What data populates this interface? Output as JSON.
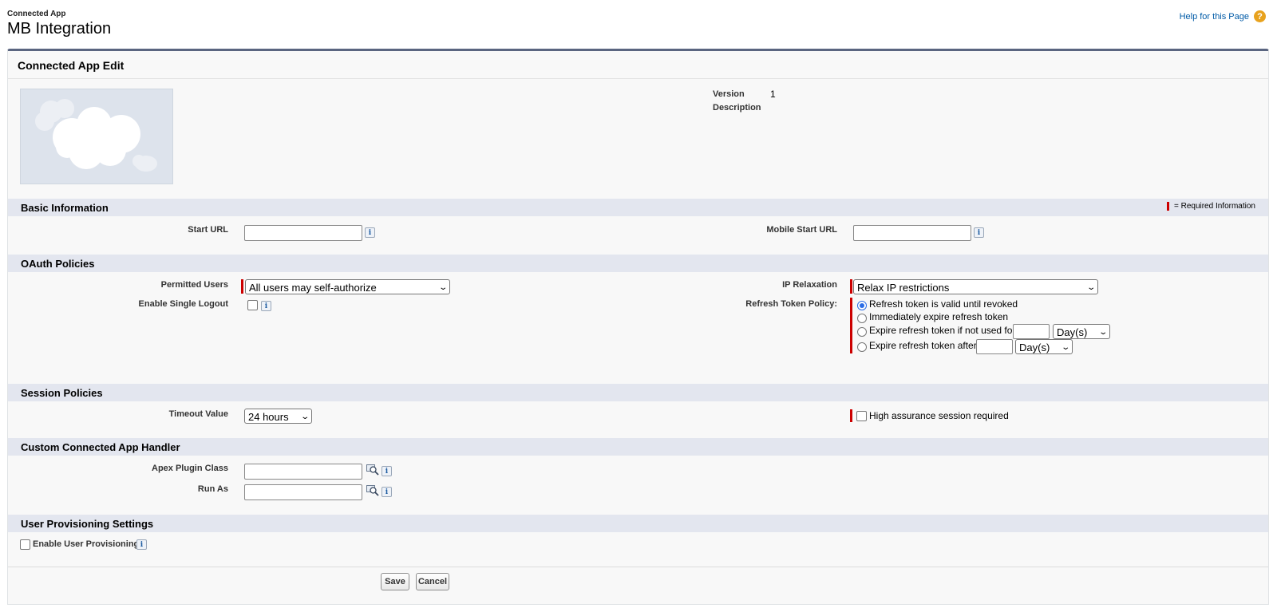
{
  "header": {
    "page_type": "Connected App",
    "title": "MB Integration",
    "help_link": "Help for this Page",
    "help_icon": "?"
  },
  "panel": {
    "title": "Connected App Edit",
    "version_label": "Version",
    "version_value": "1",
    "description_label": "Description"
  },
  "sections": {
    "basic": {
      "title": "Basic Information",
      "required_legend": "= Required Information",
      "start_url_label": "Start URL",
      "mobile_start_url_label": "Mobile Start URL"
    },
    "oauth": {
      "title": "OAuth Policies",
      "permitted_users_label": "Permitted Users",
      "permitted_users_value": "All users may self-authorize",
      "enable_single_logout_label": "Enable Single Logout",
      "ip_relaxation_label": "IP Relaxation",
      "ip_relaxation_value": "Relax IP restrictions",
      "refresh_token_label": "Refresh Token Policy:",
      "refresh_options": [
        "Refresh token is valid until revoked",
        "Immediately expire refresh token",
        "Expire refresh token if not used for",
        "Expire refresh token after"
      ],
      "unit_value": "Day(s)"
    },
    "session": {
      "title": "Session Policies",
      "timeout_label": "Timeout Value",
      "timeout_value": "24 hours",
      "high_assurance_label": "High assurance session required"
    },
    "handler": {
      "title": "Custom Connected App Handler",
      "apex_plugin_label": "Apex Plugin Class",
      "run_as_label": "Run As"
    },
    "provisioning": {
      "title": "User Provisioning Settings",
      "enable_label": "Enable User Provisioning"
    }
  },
  "buttons": {
    "save": "Save",
    "cancel": "Cancel"
  },
  "icons": {
    "info": "i",
    "chevron": "⌄"
  },
  "colors": {
    "required": "#cc0000",
    "section_bg": "#e3e6ef",
    "link": "#015ba7",
    "panel_border": "#5a6580"
  }
}
